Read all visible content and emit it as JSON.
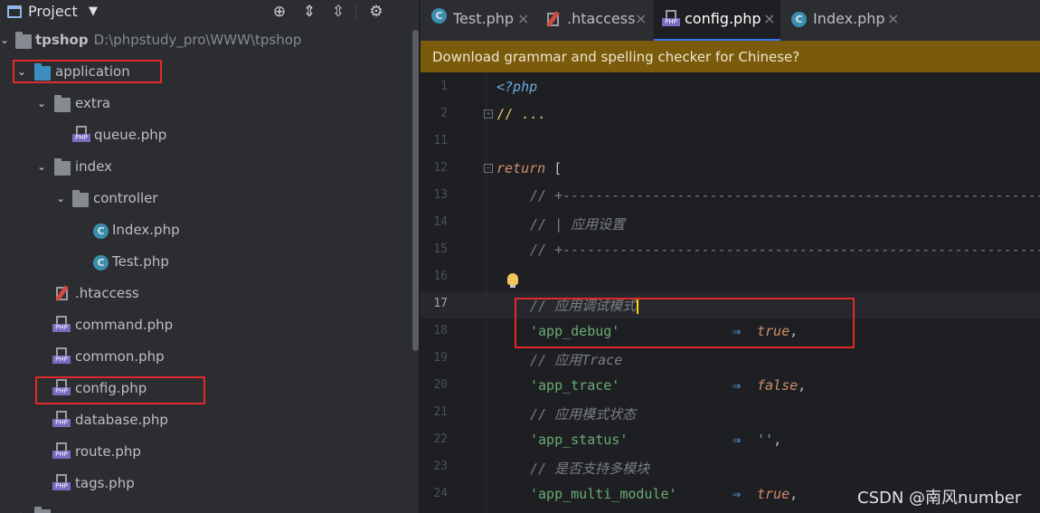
{
  "project_panel": {
    "title": "Project",
    "toolbar": [
      "locate-icon",
      "expand-all-icon",
      "collapse-all-icon",
      "gear-icon"
    ],
    "root": {
      "name": "tpshop",
      "path": "D:\\phpstudy_pro\\WWW\\tpshop"
    },
    "items": [
      {
        "label": "application"
      },
      {
        "label": "extra"
      },
      {
        "label": "queue.php"
      },
      {
        "label": "index"
      },
      {
        "label": "controller"
      },
      {
        "label": "Index.php"
      },
      {
        "label": "Test.php"
      },
      {
        "label": ".htaccess"
      },
      {
        "label": "command.php"
      },
      {
        "label": "common.php"
      },
      {
        "label": "config.php"
      },
      {
        "label": "database.php"
      },
      {
        "label": "route.php"
      },
      {
        "label": "tags.php"
      }
    ]
  },
  "tabs": [
    {
      "label": "Test.php",
      "close": "×"
    },
    {
      "label": ".htaccess",
      "close": "×"
    },
    {
      "label": "config.php",
      "close": "×",
      "active": true
    },
    {
      "label": "Index.php",
      "close": "×"
    }
  ],
  "banner": {
    "text": "Download grammar and spelling checker for Chinese?"
  },
  "editor": {
    "lines": [
      {
        "num": "1",
        "open": "<?php"
      },
      {
        "num": "2",
        "comment": "// ..."
      },
      {
        "num": "11"
      },
      {
        "num": "12",
        "keyword": "return",
        "rest": " ["
      },
      {
        "num": "13",
        "comment": "// +----------------------------------------------------------------------"
      },
      {
        "num": "14",
        "comment": "// | 应用设置"
      },
      {
        "num": "15",
        "comment": "// +----------------------------------------------------------------------"
      },
      {
        "num": "16"
      },
      {
        "num": "17",
        "comment": "// 应用调试模式"
      },
      {
        "num": "18",
        "key": "'app_debug'",
        "arrow": "⇒",
        "value": "true",
        "tail": ","
      },
      {
        "num": "19",
        "comment": "// 应用Trace"
      },
      {
        "num": "20",
        "key": "'app_trace'",
        "arrow": "⇒",
        "value": "false",
        "tail": ","
      },
      {
        "num": "21",
        "comment": "// 应用模式状态"
      },
      {
        "num": "22",
        "key": "'app_status'",
        "arrow": "⇒",
        "value": "''",
        "tail": ","
      },
      {
        "num": "23",
        "comment": "// 是否支持多模块"
      },
      {
        "num": "24",
        "key": "'app_multi_module'",
        "arrow": "⇒",
        "value": "true",
        "tail": ","
      }
    ]
  },
  "watermark": "CSDN @南风number",
  "colors": {
    "highlight_box": "#e02a2a",
    "banner": "#7a5a0b",
    "accent": "#3574f0"
  }
}
